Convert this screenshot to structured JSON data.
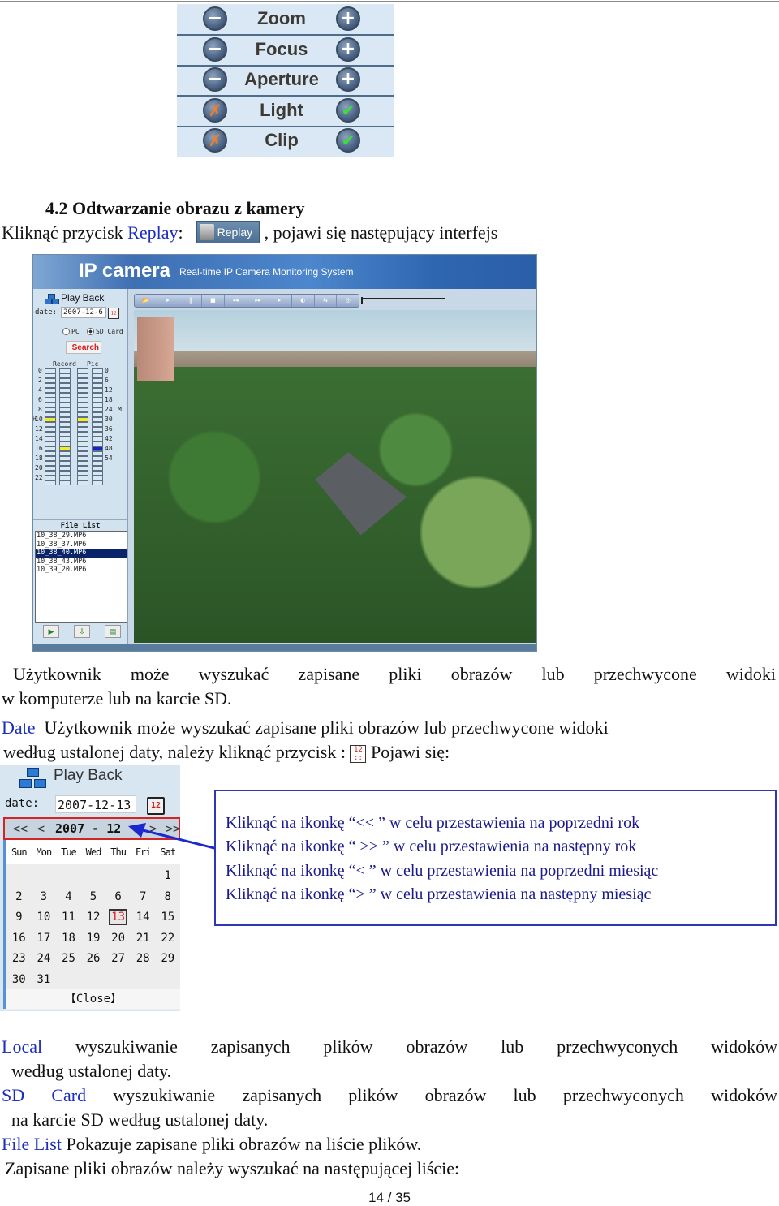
{
  "ptz_panel": {
    "rows": [
      {
        "label": "Zoom",
        "left_icon": "minus-icon",
        "right_icon": "plus-icon",
        "left_glyph": "−",
        "right_glyph": "+"
      },
      {
        "label": "Focus",
        "left_icon": "minus-icon",
        "right_icon": "plus-icon",
        "left_glyph": "−",
        "right_glyph": "+"
      },
      {
        "label": "Aperture",
        "left_icon": "minus-icon",
        "right_icon": "plus-icon",
        "left_glyph": "−",
        "right_glyph": "+"
      },
      {
        "label": "Light",
        "left_icon": "x-icon",
        "right_icon": "check-icon",
        "left_glyph": "✗",
        "right_glyph": "✔"
      },
      {
        "label": "Clip",
        "left_icon": "x-icon",
        "right_icon": "check-icon",
        "left_glyph": "✗",
        "right_glyph": "✔"
      }
    ]
  },
  "section": {
    "heading": "4.2 Odtwarzanie obrazu z kamery",
    "intro_prefix": "Kliknąć przycisk ",
    "intro_link": "Replay",
    "intro_colon": ":",
    "replay_button_label": "Replay",
    "intro_suffix": ", pojawi się następujący interfejs"
  },
  "app": {
    "logo": "IP camera",
    "subtitle": "Real-time IP Camera Monitoring System",
    "sidebar": {
      "title": "Play Back",
      "date_label": "date:",
      "date_value": "2007-12-6",
      "radio_pc": "PC",
      "radio_sd": "SD Card",
      "search_label": "Search",
      "record_label": "Record",
      "pic_label": "Pic",
      "left_ticks": [
        "0",
        "2",
        "4",
        "6",
        "8",
        "10",
        "12",
        "14",
        "16",
        "18",
        "20",
        "22"
      ],
      "right_ticks": [
        "0",
        "6",
        "12",
        "18",
        "24",
        "30",
        "36",
        "42",
        "48",
        "54"
      ],
      "left_marker": "H",
      "right_marker": "M",
      "file_list_title": "File List",
      "files": [
        "10_38_29.MP6",
        "10_38_37.MP6",
        "10_38_40.MP6",
        "10_38_43.MP6",
        "10_39_20.MP6"
      ],
      "selected_file": "10_38_40.MP6"
    },
    "toolbar": [
      "open-folder",
      "play",
      "pause",
      "stop",
      "rewind",
      "fast-forward",
      "step",
      "volume",
      "loop",
      "snapshot"
    ],
    "toolbar_glyphs": [
      "📂",
      "▸",
      "‖",
      "■",
      "◂◂",
      "▸▸",
      "▸|",
      "◐",
      "⇆",
      "◎"
    ]
  },
  "paragraphs": {
    "p1_line1": "Użytkownik może wyszukać zapisane pliki obrazów lub przechwycone widoki",
    "p1_line2": "w komputerze lub na karcie SD.",
    "date_term": "Date",
    "p2_line1": "  Użytkownik może wyszukać zapisane pliki obrazów lub przechwycone widoki",
    "p2_line2_prefix": "według ustalonej daty, należy kliknąć przycisk : ",
    "p2_line2_suffix": " Pojawi się:"
  },
  "popup": {
    "title": "Play Back",
    "date_label": "date:",
    "date_value": "2007-12-13",
    "calendar_icon_text": "12",
    "nav": {
      "prev_year": "<<",
      "prev_month": "<",
      "year_month": "2007 - 12",
      "next_month": ">",
      "next_year": ">>"
    },
    "weekdays": [
      "Sun",
      "Mon",
      "Tue",
      "Wed",
      "Thu",
      "Fri",
      "Sat"
    ],
    "weeks": [
      [
        "",
        "",
        "",
        "",
        "",
        "",
        "1"
      ],
      [
        "2",
        "3",
        "4",
        "5",
        "6",
        "7",
        "8"
      ],
      [
        "9",
        "10",
        "11",
        "12",
        "13",
        "14",
        "15"
      ],
      [
        "16",
        "17",
        "18",
        "19",
        "20",
        "21",
        "22"
      ],
      [
        "23",
        "24",
        "25",
        "26",
        "27",
        "28",
        "29"
      ],
      [
        "30",
        "31",
        "",
        "",
        "",
        "",
        ""
      ]
    ],
    "selected_day": "13",
    "close_label": "【Close】"
  },
  "notes": [
    "Kliknąć na ikonkę “<< ” w celu przestawienia na poprzedni rok",
    "Kliknąć na ikonkę “ >> ” w celu przestawienia na następny rok",
    "Kliknąć na ikonkę “< ” w celu przestawienia na poprzedni miesiąc",
    "Kliknąć na ikonkę “> ” w celu przestawienia na następny miesiąc"
  ],
  "definitions": [
    {
      "term": "Local",
      "line1": " wyszukiwanie zapisanych plików obrazów lub przechwyconych widoków",
      "line2": "według ustalonej daty."
    },
    {
      "term": "SD Card",
      "line1": " wyszukiwanie zapisanych plików obrazów lub przechwyconych widoków",
      "line2": "na karcie SD według ustalonej daty."
    },
    {
      "term": "File List",
      "line1": " Pokazuje zapisane pliki obrazów na liście plików.",
      "line2": ""
    }
  ],
  "closing_line": "Zapisane pliki obrazów należy wyszukać na następującej liście:",
  "page_number": "14 / 35",
  "colors": {
    "link_blue": "#1b2dbd",
    "note_navy": "#1a1a8c",
    "highlight_red": "#d42323",
    "record_yellow": "#f2ea2a",
    "pic_blue": "#1623c9"
  }
}
